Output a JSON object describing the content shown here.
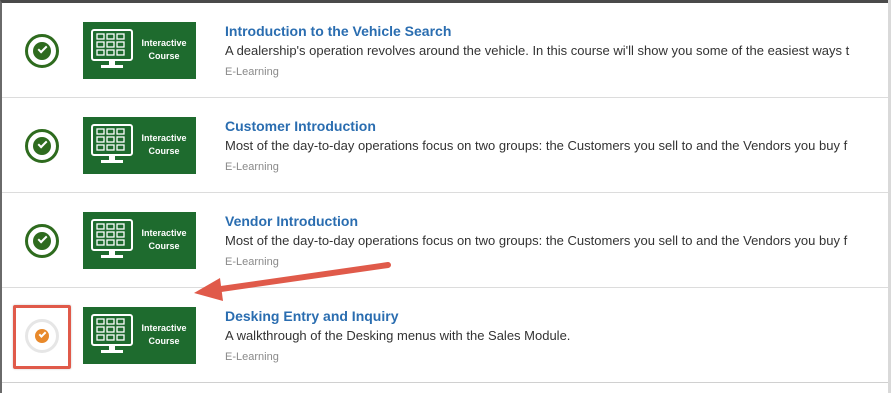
{
  "colors": {
    "link": "#2a6db0",
    "complete": "#2e6b1e",
    "in_progress": "#e8892b",
    "thumbnail_bg": "#1e6b2e",
    "annotation": "#e05a4a"
  },
  "courses": [
    {
      "status": "complete",
      "status_icon": "check-circle-icon",
      "thumbnail_text_1": "Interactive",
      "thumbnail_text_2": "Course",
      "title": "Introduction to the Vehicle Search",
      "description": "A dealership's operation revolves around the vehicle.  In this course wi'll show you some of the easiest ways t",
      "type": "E-Learning"
    },
    {
      "status": "complete",
      "status_icon": "check-circle-icon",
      "thumbnail_text_1": "Interactive",
      "thumbnail_text_2": "Course",
      "title": "Customer Introduction",
      "description": "Most of the day-to-day operations focus on two groups: the Customers you sell to and the Vendors you buy f",
      "type": "E-Learning"
    },
    {
      "status": "complete",
      "status_icon": "check-circle-icon",
      "thumbnail_text_1": "Interactive",
      "thumbnail_text_2": "Course",
      "title": "Vendor Introduction",
      "description": "Most of the day-to-day operations focus on two groups: the Customers you sell to and the Vendors you buy f",
      "type": "E-Learning"
    },
    {
      "status": "in-progress",
      "status_icon": "in-progress-check-icon",
      "thumbnail_text_1": "Interactive",
      "thumbnail_text_2": "Course",
      "title": "Desking Entry and Inquiry",
      "description": "A walkthrough of the Desking menus with the Sales Module.",
      "type": "E-Learning"
    }
  ],
  "annotations": {
    "highlight_box": "annotation-highlight",
    "arrow": "annotation-arrow"
  }
}
